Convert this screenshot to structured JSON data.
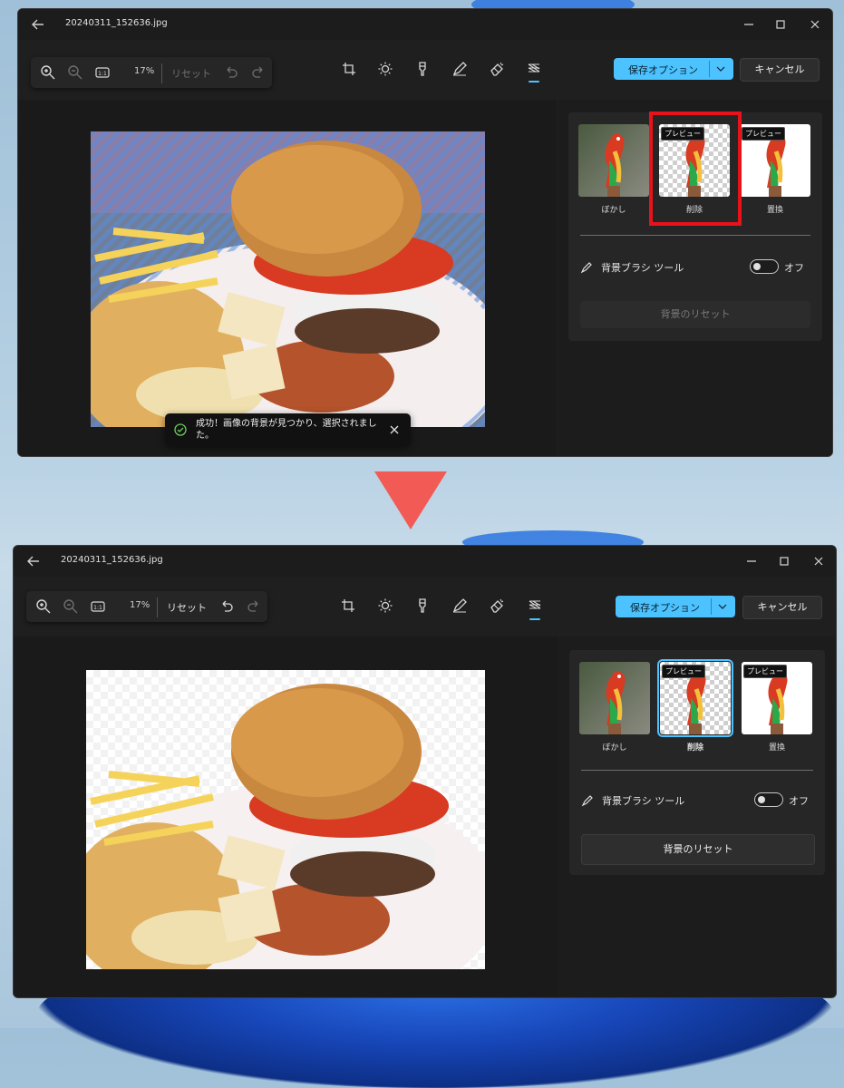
{
  "app": {
    "filename": "20240311_152636.jpg"
  },
  "toolbar": {
    "zoom_percent": "17%",
    "reset_label": "リセット",
    "save_label": "保存オプション",
    "cancel_label": "キャンセル",
    "zoom_in_icon": "zoom-in-icon",
    "zoom_out_icon": "zoom-out-icon",
    "actual_size_icon": "actual-size-icon",
    "undo_icon": "undo-icon",
    "redo_icon": "redo-icon",
    "tools": [
      "crop-icon",
      "brightness-icon",
      "markup-icon",
      "pen-icon",
      "erase-icon",
      "background-icon"
    ],
    "active_tool": "background-icon"
  },
  "background_panel": {
    "options": [
      {
        "label": "ぼかし",
        "preview": ""
      },
      {
        "label": "削除",
        "preview": "プレビュー"
      },
      {
        "label": "置換",
        "preview": "プレビュー"
      }
    ],
    "brush_tool_label": "背景ブラシ ツール",
    "toggle_state": "オフ",
    "reset_button_label": "背景のリセット"
  },
  "toast": {
    "message": "成功！画像の背景が見つかり、選択されました。"
  },
  "colors": {
    "accent": "#4cc2ff",
    "highlight": "#e8131a",
    "arrow": "#f25a55",
    "window_bg": "#1f1f1f"
  }
}
